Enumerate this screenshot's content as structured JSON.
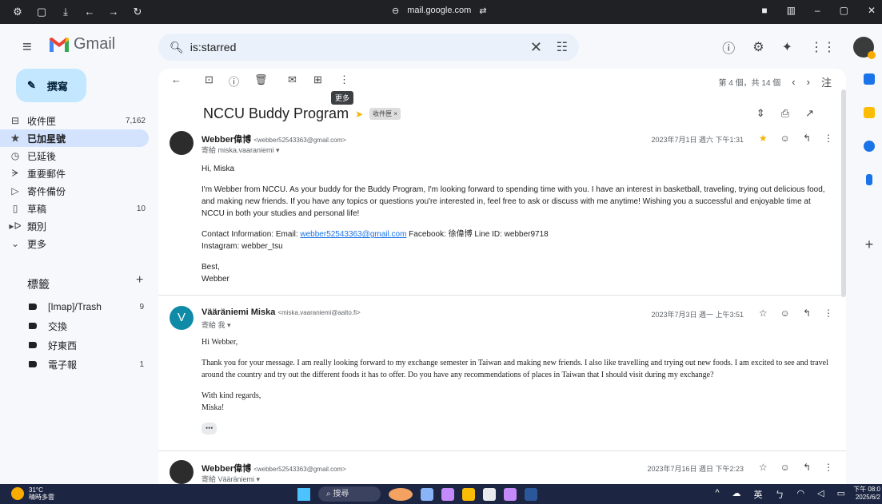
{
  "browser": {
    "url": "mail.google.com",
    "nav_icons": [
      "back-icon",
      "forward-icon",
      "reload-icon"
    ]
  },
  "header": {
    "app_name": "Gmail",
    "search_query": "is:starred"
  },
  "sidebar": {
    "compose_label": "撰寫",
    "items": [
      {
        "label": "收件匣",
        "count": "7,162",
        "icon": "inbox-icon"
      },
      {
        "label": "已加星號",
        "count": "",
        "icon": "star-icon"
      },
      {
        "label": "已延後",
        "count": "",
        "icon": "clock-icon"
      },
      {
        "label": "重要郵件",
        "count": "",
        "icon": "important-icon"
      },
      {
        "label": "寄件備份",
        "count": "",
        "icon": "send-icon"
      },
      {
        "label": "草稿",
        "count": "10",
        "icon": "draft-icon"
      },
      {
        "label": "類別",
        "count": "",
        "icon": "label-icon"
      },
      {
        "label": "更多",
        "count": "",
        "icon": "chevron-down-icon"
      }
    ],
    "labels_title": "標籤",
    "labels": [
      {
        "label": "[Imap]/Trash",
        "count": "9"
      },
      {
        "label": "交換",
        "count": ""
      },
      {
        "label": "好東西",
        "count": ""
      },
      {
        "label": "電子報",
        "count": "1"
      }
    ]
  },
  "thread": {
    "tooltip": "更多",
    "pager": "第 4 個，共 14 個",
    "lang_switch": "注",
    "subject": "NCCU Buddy Program",
    "inbox_chip": "收件匣 ×",
    "messages": [
      {
        "sender": "Webber偉博",
        "email": "<webber52543363@gmail.com>",
        "to": "寄給 miska.vaaraniemi ▾",
        "date": "2023年7月1日 週六 下午1:31",
        "greeting": "Hi, Miska",
        "para1": "I'm Webber from NCCU. As your buddy for the Buddy Program, I'm looking forward to spending time with you. I have an interest in basketball, traveling, trying out delicious food, and making new friends. If you have any topics or questions you're interested in, feel free to ask or discuss with me anytime! Wishing you a successful and enjoyable time at NCCU in both your studies and personal life!",
        "contact_prefix": "Contact Information: Email: ",
        "contact_email": "webber52543363@gmail.com",
        "contact_suffix": " Facebook: 徐偉博 Line ID: webber9718",
        "instagram": "Instagram: webber_tsu",
        "closing": "Best,",
        "signature": "Webber"
      },
      {
        "sender": "Vääräniemi Miska",
        "avatar_letter": "V",
        "email": "<miska.vaaraniemi@aalto.fi>",
        "to": "寄給 我 ▾",
        "date": "2023年7月3日 週一 上午3:51",
        "greeting": "Hi Webber,",
        "para1": "Thank you for your message. I am really looking forward to my exchange semester in Taiwan and making new friends. I also like travelling and trying out new foods. I am excited to see and travel around the country and try out the different foods it has to offer.  Do you have any recommendations of places in Taiwan that I should visit during my exchange?",
        "closing": "With kind regards,",
        "signature": "Miska!",
        "dots": "•••"
      },
      {
        "sender": "Webber偉博",
        "email": "<webber52543363@gmail.com>",
        "to": "寄給 Vääräniemi ▾",
        "date": "2023年7月16日 週日 下午2:23"
      }
    ]
  },
  "taskbar": {
    "temperature": "31°C",
    "weather": "晴時多雲",
    "search": "搜尋",
    "ime": "英",
    "time": "下午 08:0",
    "date": "2025/6/2"
  },
  "colors": {
    "accent": "#1a73e8",
    "star": "#f4b400",
    "compose": "#c2e7ff",
    "active": "#d3e3fd"
  }
}
